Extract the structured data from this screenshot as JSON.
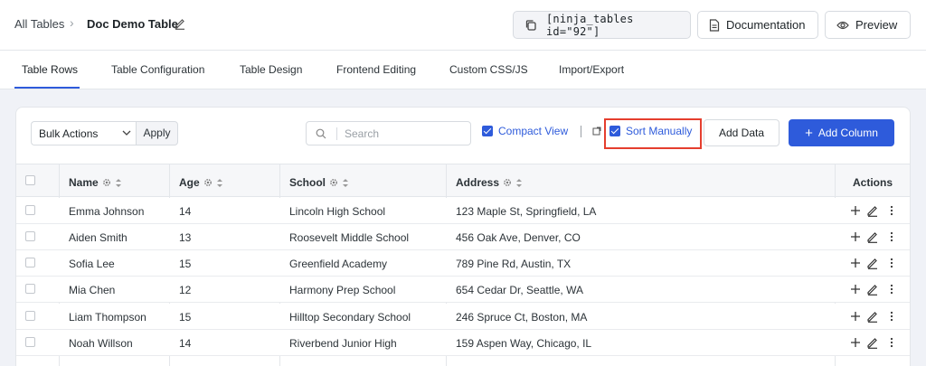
{
  "breadcrumb": {
    "root": "All Tables",
    "separator": "›",
    "current": "Doc Demo Table"
  },
  "header_buttons": {
    "shortcode": "[ninja_tables id=\"92\"]",
    "documentation": "Documentation",
    "preview": "Preview"
  },
  "tabs": [
    {
      "label": "Table Rows",
      "active": true
    },
    {
      "label": "Table Configuration"
    },
    {
      "label": "Table Design"
    },
    {
      "label": "Frontend Editing"
    },
    {
      "label": "Custom CSS/JS"
    },
    {
      "label": "Import/Export"
    }
  ],
  "toolbar": {
    "bulk_actions": "Bulk Actions",
    "apply": "Apply",
    "search_placeholder": "Search",
    "compact_view": {
      "label": "Compact View",
      "checked": true
    },
    "sort_manually": {
      "label": "Sort Manually",
      "checked": true,
      "highlighted": true
    },
    "add_data": "Add Data",
    "add_column": "Add Column"
  },
  "table": {
    "columns": [
      "Name",
      "Age",
      "School",
      "Address"
    ],
    "actions_header": "Actions",
    "rows": [
      {
        "name": "Emma Johnson",
        "age": "14",
        "school": "Lincoln High School",
        "address": "123 Maple St, Springfield, LA"
      },
      {
        "name": "Aiden Smith",
        "age": "13",
        "school": "Roosevelt Middle School",
        "address": "456 Oak Ave, Denver, CO"
      },
      {
        "name": "Sofia Lee",
        "age": "15",
        "school": "Greenfield Academy",
        "address": "789 Pine Rd, Austin, TX"
      },
      {
        "name": "Mia Chen",
        "age": "12",
        "school": "Harmony Prep School",
        "address": "654 Cedar Dr, Seattle, WA"
      },
      {
        "name": "Liam Thompson",
        "age": "15",
        "school": "Hilltop Secondary School",
        "address": "246 Spruce Ct, Boston, MA"
      },
      {
        "name": "Noah Willson",
        "age": "14",
        "school": "Riverbend Junior High",
        "address": "159 Aspen Way, Chicago, IL"
      }
    ]
  },
  "colors": {
    "accent": "#2e5bdb",
    "highlight_border": "#e53e2e"
  }
}
